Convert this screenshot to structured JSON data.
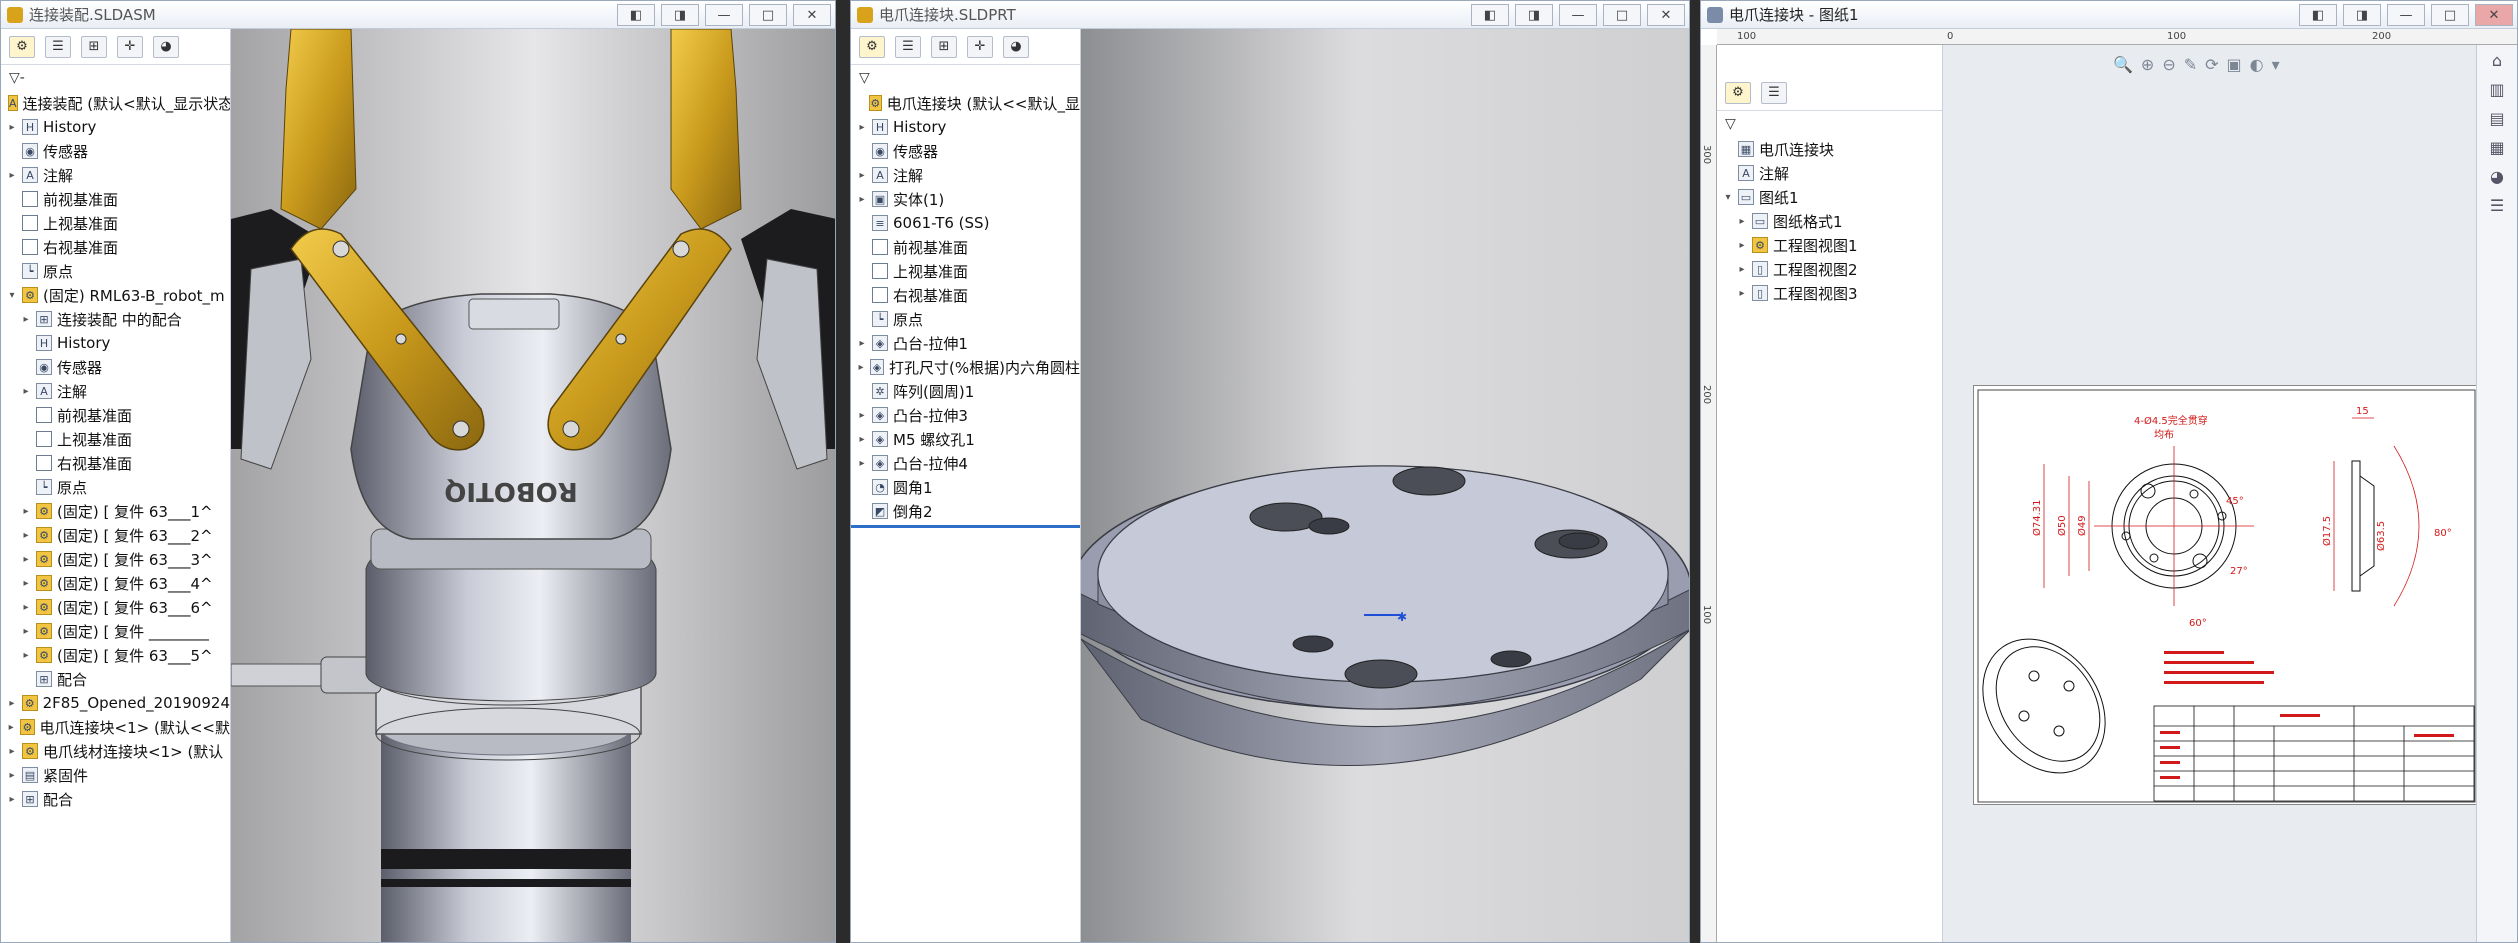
{
  "windows": {
    "assembly": {
      "title": "连接装配.SLDASM",
      "buttons": [
        "◧",
        "◨",
        "—",
        "□",
        "✕"
      ],
      "tabs": [
        "⚙",
        "☰",
        "⊞",
        "✛",
        "◕"
      ],
      "tree": [
        {
          "exp": "",
          "icon": "A",
          "gold": true,
          "label": "连接装配 (默认<默认_显示状态"
        },
        {
          "exp": "▸",
          "icon": "H",
          "label": "History"
        },
        {
          "exp": "",
          "icon": "◉",
          "label": "传感器"
        },
        {
          "exp": "▸",
          "icon": "A",
          "label": "注解"
        },
        {
          "exp": "",
          "icon": "",
          "plane": true,
          "label": "前视基准面"
        },
        {
          "exp": "",
          "icon": "",
          "plane": true,
          "label": "上视基准面"
        },
        {
          "exp": "",
          "icon": "",
          "plane": true,
          "label": "右视基准面"
        },
        {
          "exp": "",
          "icon": "┕",
          "label": "原点"
        },
        {
          "exp": "▾",
          "icon": "⚙",
          "gold": true,
          "label": "(固定) RML63-B_robot_m"
        },
        {
          "exp": "▸",
          "icon": "⊞",
          "label": "连接装配 中的配合",
          "indent": 1
        },
        {
          "exp": "",
          "icon": "H",
          "label": "History",
          "indent": 1
        },
        {
          "exp": "",
          "icon": "◉",
          "label": "传感器",
          "indent": 1
        },
        {
          "exp": "▸",
          "icon": "A",
          "label": "注解",
          "indent": 1
        },
        {
          "exp": "",
          "icon": "",
          "plane": true,
          "label": "前视基准面",
          "indent": 1
        },
        {
          "exp": "",
          "icon": "",
          "plane": true,
          "label": "上视基准面",
          "indent": 1
        },
        {
          "exp": "",
          "icon": "",
          "plane": true,
          "label": "右视基准面",
          "indent": 1
        },
        {
          "exp": "",
          "icon": "┕",
          "label": "原点",
          "indent": 1
        },
        {
          "exp": "▸",
          "icon": "⚙",
          "gold": true,
          "label": "(固定) [ 复件 63___1^",
          "indent": 1
        },
        {
          "exp": "▸",
          "icon": "⚙",
          "gold": true,
          "label": "(固定) [ 复件 63___2^",
          "indent": 1
        },
        {
          "exp": "▸",
          "icon": "⚙",
          "gold": true,
          "label": "(固定) [ 复件 63___3^",
          "indent": 1
        },
        {
          "exp": "▸",
          "icon": "⚙",
          "gold": true,
          "label": "(固定) [ 复件 63___4^",
          "indent": 1
        },
        {
          "exp": "▸",
          "icon": "⚙",
          "gold": true,
          "label": "(固定) [ 复件 63___6^",
          "indent": 1
        },
        {
          "exp": "▸",
          "icon": "⚙",
          "gold": true,
          "label": "(固定) [ 复件 ________",
          "indent": 1
        },
        {
          "exp": "▸",
          "icon": "⚙",
          "gold": true,
          "label": "(固定) [ 复件 63___5^",
          "indent": 1
        },
        {
          "exp": "",
          "icon": "⊞",
          "label": "配合",
          "indent": 1
        },
        {
          "exp": "▸",
          "icon": "⚙",
          "gold": true,
          "label": "2F85_Opened_20190924"
        },
        {
          "exp": "▸",
          "icon": "⚙",
          "gold": true,
          "label": "电爪连接块<1> (默认<<默"
        },
        {
          "exp": "▸",
          "icon": "⚙",
          "gold": true,
          "label": "电爪线材连接块<1> (默认"
        },
        {
          "exp": "▸",
          "icon": "▤",
          "label": "紧固件"
        },
        {
          "exp": "▸",
          "icon": "⊞",
          "label": "配合"
        }
      ]
    },
    "part": {
      "title": "电爪连接块.SLDPRT",
      "buttons": [
        "◧",
        "◨",
        "—",
        "□",
        "✕"
      ],
      "tabs": [
        "⚙",
        "☰",
        "⊞",
        "✛",
        "◕"
      ],
      "tree": [
        {
          "exp": "",
          "icon": "⚙",
          "gold": true,
          "label": "电爪连接块 (默认<<默认_显"
        },
        {
          "exp": "▸",
          "icon": "H",
          "label": "History"
        },
        {
          "exp": "",
          "icon": "◉",
          "label": "传感器"
        },
        {
          "exp": "▸",
          "icon": "A",
          "label": "注解"
        },
        {
          "exp": "▸",
          "icon": "▣",
          "label": "实体(1)"
        },
        {
          "exp": "",
          "icon": "≡",
          "label": "6061-T6 (SS)"
        },
        {
          "exp": "",
          "icon": "",
          "plane": true,
          "label": "前视基准面"
        },
        {
          "exp": "",
          "icon": "",
          "plane": true,
          "label": "上视基准面"
        },
        {
          "exp": "",
          "icon": "",
          "plane": true,
          "label": "右视基准面"
        },
        {
          "exp": "",
          "icon": "┕",
          "label": "原点"
        },
        {
          "exp": "▸",
          "icon": "◈",
          "label": "凸台-拉伸1"
        },
        {
          "exp": "▸",
          "icon": "◈",
          "label": "打孔尺寸(%根据)内六角圆柱"
        },
        {
          "exp": "",
          "icon": "✲",
          "label": "阵列(圆周)1"
        },
        {
          "exp": "▸",
          "icon": "◈",
          "label": "凸台-拉伸3"
        },
        {
          "exp": "▸",
          "icon": "◈",
          "label": "M5 螺纹孔1"
        },
        {
          "exp": "▸",
          "icon": "◈",
          "label": "凸台-拉伸4"
        },
        {
          "exp": "",
          "icon": "◔",
          "label": "圆角1"
        },
        {
          "exp": "",
          "icon": "◩",
          "label": "倒角2"
        }
      ]
    },
    "drawing": {
      "title": "电爪连接块 - 图纸1",
      "buttons": [
        "◧",
        "◨",
        "—",
        "□",
        "✕"
      ],
      "tabs": [
        "⚙",
        "☰"
      ],
      "ruler_top": [
        "100",
        "0",
        "100",
        "200"
      ],
      "ruler_left": [
        "300",
        "200",
        "100"
      ],
      "tree": [
        {
          "exp": "",
          "icon": "▦",
          "label": "电爪连接块"
        },
        {
          "exp": "",
          "icon": "A",
          "label": "注解"
        },
        {
          "exp": "▾",
          "icon": "▭",
          "label": "图纸1"
        },
        {
          "exp": "▸",
          "icon": "▭",
          "label": "图纸格式1",
          "indent": 1
        },
        {
          "exp": "▸",
          "icon": "⚙",
          "gold": true,
          "label": "工程图视图1",
          "indent": 1
        },
        {
          "exp": "▸",
          "icon": "▯",
          "label": "工程图视图2",
          "indent": 1
        },
        {
          "exp": "▸",
          "icon": "▯",
          "label": "工程图视图3",
          "indent": 1
        }
      ],
      "sheet_dims": {
        "d1": "4-Ø4.5完全贯穿",
        "d2": "Ø74.31",
        "d3": "Ø49",
        "d4": "Ø50",
        "d5": "45°",
        "d6": "27°",
        "d7": "60°",
        "d8": "80°",
        "d9": "15",
        "d10": "Ø17.5",
        "d11": "Ø63.5",
        "d12": "均布"
      }
    }
  },
  "colors": {
    "gripper_gold": "#c99a1c",
    "drawing_red": "#d21919"
  }
}
